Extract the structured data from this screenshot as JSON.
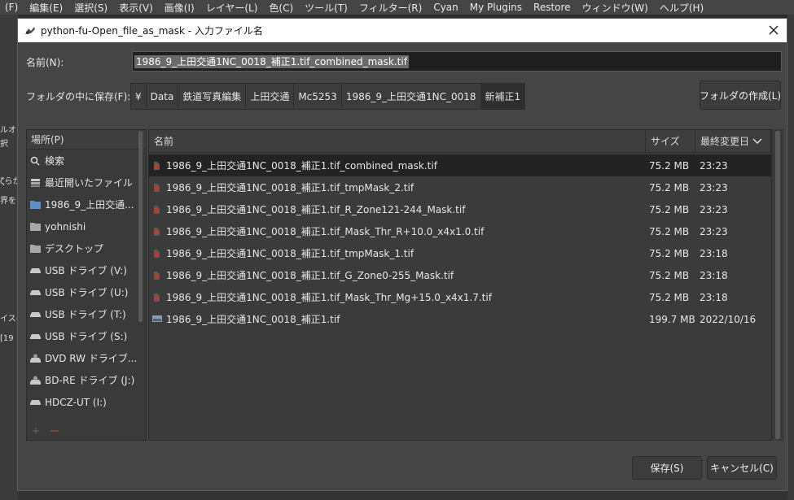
{
  "menubar": [
    "(F)",
    "編集(E)",
    "選択(S)",
    "表示(V)",
    "画像(I)",
    "レイヤー(L)",
    "色(C)",
    "ツール(T)",
    "フィルター(R)",
    "Cyan",
    "My Plugins",
    "Restore",
    "ウィンドウ(W)",
    "ヘルプ(H)"
  ],
  "background": {
    "left_fragments": [
      "ルオブ",
      "択",
      "ζらか",
      "界をに",
      "イスの",
      "[19"
    ]
  },
  "dialog": {
    "title": "python-fu-Open_file_as_mask - 入力ファイル名",
    "name_label": "名前(N):",
    "name_value": "1986_9_上田交通1NC_0018_補正1.tif_combined_mask.tif",
    "folder_label": "フォルダの中に保存(F):",
    "breadcrumbs": [
      "¥",
      "Data",
      "鉄道写真編集",
      "上田交通",
      "Mc5253",
      "1986_9_上田交通1NC_0018",
      "新補正1"
    ],
    "create_folder_label": "フォルダの作成(L)",
    "places_header": "場所(P)",
    "places": [
      {
        "label": "検索",
        "icon": "search-icon"
      },
      {
        "label": "最近開いたファイル",
        "icon": "recent-icon"
      },
      {
        "label": "1986_9_上田交通...",
        "icon": "folder-icon"
      },
      {
        "label": "yohnishi",
        "icon": "home-folder-icon"
      },
      {
        "label": "デスクトップ",
        "icon": "desktop-folder-icon"
      },
      {
        "label": "USB ドライブ (V:)",
        "icon": "drive-icon"
      },
      {
        "label": "USB ドライブ (U:)",
        "icon": "drive-icon"
      },
      {
        "label": "USB ドライブ (T:)",
        "icon": "drive-icon"
      },
      {
        "label": "USB ドライブ (S:)",
        "icon": "drive-icon"
      },
      {
        "label": "DVD RW ドライブ...",
        "icon": "optical-drive-icon"
      },
      {
        "label": "BD-RE ドライブ (J:)",
        "icon": "optical-drive-icon"
      },
      {
        "label": "HDCZ-UT (I:)",
        "icon": "drive-icon"
      }
    ],
    "columns": {
      "name": "名前",
      "size": "サイズ",
      "modified": "最終変更日"
    },
    "files": [
      {
        "name": "1986_9_上田交通1NC_0018_補正1.tif_combined_mask.tif",
        "size": "75.2 MB",
        "modified": "23:23",
        "selected": true
      },
      {
        "name": "1986_9_上田交通1NC_0018_補正1.tif_tmpMask_2.tif",
        "size": "75.2 MB",
        "modified": "23:23"
      },
      {
        "name": "1986_9_上田交通1NC_0018_補正1.tif_R_Zone121-244_Mask.tif",
        "size": "75.2 MB",
        "modified": "23:23"
      },
      {
        "name": "1986_9_上田交通1NC_0018_補正1.tif_Mask_Thr_R+10.0_x4x1.0.tif",
        "size": "75.2 MB",
        "modified": "23:23"
      },
      {
        "name": "1986_9_上田交通1NC_0018_補正1.tif_tmpMask_1.tif",
        "size": "75.2 MB",
        "modified": "23:18"
      },
      {
        "name": "1986_9_上田交通1NC_0018_補正1.tif_G_Zone0-255_Mask.tif",
        "size": "75.2 MB",
        "modified": "23:18"
      },
      {
        "name": "1986_9_上田交通1NC_0018_補正1.tif_Mask_Thr_Mg+15.0_x4x1.7.tif",
        "size": "75.2 MB",
        "modified": "23:18"
      },
      {
        "name": "1986_9_上田交通1NC_0018_補正1.tif",
        "size": "199.7 MB",
        "modified": "2022/10/16"
      }
    ],
    "save_label": "保存(S)",
    "cancel_label": "キャンセル(C)"
  },
  "colors": {
    "dialog_bg": "#454545",
    "list_bg": "#3b3b3b",
    "selected_row": "#232323",
    "titlebar": "#ffffff"
  }
}
